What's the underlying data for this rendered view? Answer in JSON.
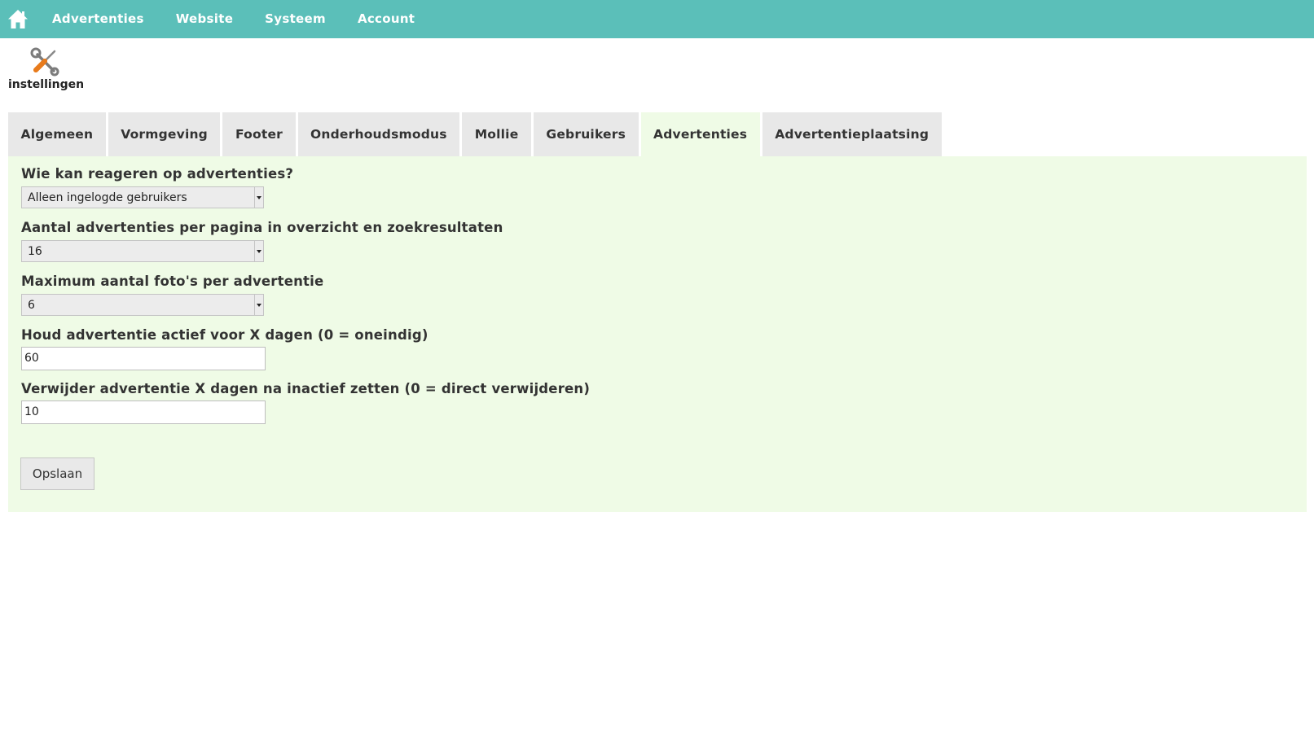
{
  "nav": {
    "home_icon": "home-icon",
    "items": [
      {
        "label": "Advertenties"
      },
      {
        "label": "Website"
      },
      {
        "label": "Systeem"
      },
      {
        "label": "Account"
      }
    ]
  },
  "page": {
    "icon": "tools-icon",
    "title": "instellingen"
  },
  "tabs": [
    {
      "label": "Algemeen",
      "active": false
    },
    {
      "label": "Vormgeving",
      "active": false
    },
    {
      "label": "Footer",
      "active": false
    },
    {
      "label": "Onderhoudsmodus",
      "active": false
    },
    {
      "label": "Mollie",
      "active": false
    },
    {
      "label": "Gebruikers",
      "active": false
    },
    {
      "label": "Advertenties",
      "active": true
    },
    {
      "label": "Advertentieplaatsing",
      "active": false
    }
  ],
  "form": {
    "fields": [
      {
        "label": "Wie kan reageren op advertenties?",
        "type": "select",
        "value": "Alleen ingelogde gebruikers"
      },
      {
        "label": "Aantal advertenties per pagina in overzicht en zoekresultaten",
        "type": "select",
        "value": "16"
      },
      {
        "label": "Maximum aantal foto's per advertentie",
        "type": "select",
        "value": "6"
      },
      {
        "label": "Houd advertentie actief voor X dagen (0 = oneindig)",
        "type": "text",
        "value": "60"
      },
      {
        "label": "Verwijder advertentie X dagen na inactief zetten (0 = direct verwijderen)",
        "type": "text",
        "value": "10"
      }
    ],
    "save_label": "Opslaan"
  },
  "colors": {
    "topbar": "#5bbfb9",
    "panel": "#effbe6",
    "tab": "#e8e8e8"
  }
}
